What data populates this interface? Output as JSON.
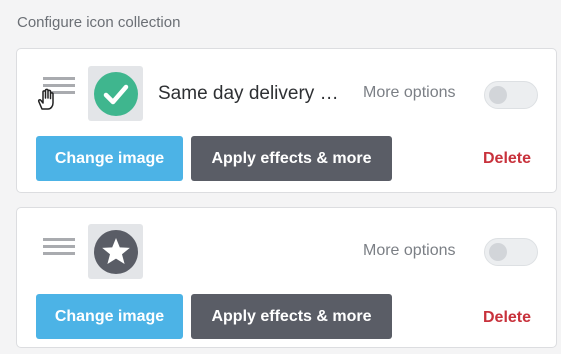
{
  "section": {
    "title": "Configure icon collection"
  },
  "items": [
    {
      "title": "Same day delivery …",
      "icon": "checkmark-circle-icon",
      "icon_color": "#3fb68e",
      "more_options_label": "More options",
      "toggle_on": false,
      "change_image_label": "Change image",
      "apply_effects_label": "Apply effects & more",
      "delete_label": "Delete"
    },
    {
      "title": "",
      "icon": "star-circle-icon",
      "icon_color": "#5a5d66",
      "more_options_label": "More options",
      "toggle_on": false,
      "change_image_label": "Change image",
      "apply_effects_label": "Apply effects & more",
      "delete_label": "Delete"
    }
  ],
  "colors": {
    "primary_button": "#4cb3e6",
    "secondary_button": "#5a5d66",
    "danger_text": "#c8323c"
  }
}
